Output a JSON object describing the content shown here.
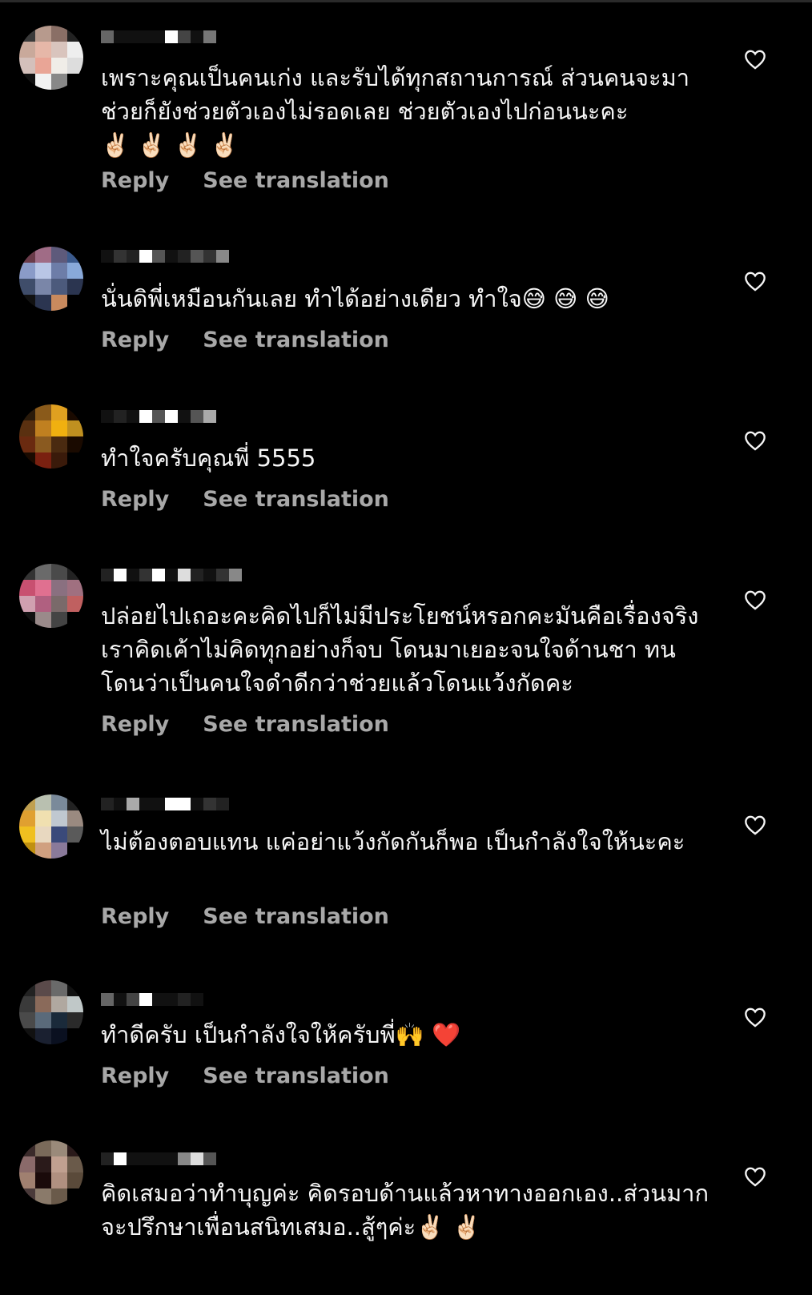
{
  "reply_label": "Reply",
  "translate_label": "See translation",
  "comments": [
    {
      "text": "เพราะคุณเป็นคนเก่ง และรับได้ทุกสถานการณ์ ส่วนคนจะมาช่วยก็ยังช่วยตัวเองไม่รอดเลย ช่วยตัวเองไปก่อนนะคะ\n✌🏻 ✌🏻 ✌🏻 ✌🏻"
    },
    {
      "text": "นั่นดิพี่เหมือนกันเลย ทำได้อย่างเดียว ทำใจ😅 😅 😅"
    },
    {
      "text": "ทำใจครับคุณพี่ 5555"
    },
    {
      "text": "ปล่อยไปเถอะคะคิดไปก็ไม่มีประโยชน์หรอกคะมันคือเรื่องจริง เราคิดเค้าไม่คิดทุกอย่างก็จบ โดนมาเยอะจนใจด้านชา ทนโดนว่าเป็นคนใจดำดีกว่าช่วยแล้วโดนแว้งกัดคะ"
    },
    {
      "text": "ไม่ต้องตอบแทน แค่อย่าแว้งกัดกันก็พอ เป็นกำลังใจให้นะคะ"
    },
    {
      "text": "ทำดีครับ เป็นกำลังใจให้ครับพี่🙌 ❤️"
    },
    {
      "text": "คิดเสมอว่าทำบุญค่ะ คิดรอบด้านแล้วหาทางออกเอง..ส่วนมากจะปรึกษาเพื่อนสนิทเสมอ..สู้ๆค่ะ✌🏻 ✌🏻"
    }
  ],
  "icons": {
    "like": "heart-outline-icon",
    "avatar": "pixelated-avatar"
  },
  "colors": {
    "background": "#000000",
    "text": "#f5f5f5",
    "secondary": "#a8a8a8"
  }
}
